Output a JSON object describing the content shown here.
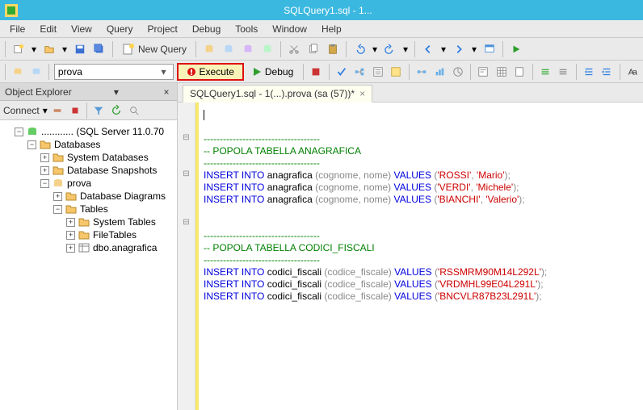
{
  "titlebar": {
    "title": "SQLQuery1.sql - 1..."
  },
  "menu": {
    "file": "File",
    "edit": "Edit",
    "view": "View",
    "query": "Query",
    "project": "Project",
    "debug": "Debug",
    "tools": "Tools",
    "window": "Window",
    "help": "Help"
  },
  "toolbar1": {
    "new_query": "New Query"
  },
  "toolbar2": {
    "combo_value": "prova",
    "execute": "Execute",
    "debug": "Debug"
  },
  "obj_explorer": {
    "title": "Object Explorer",
    "connect": "Connect"
  },
  "tree": {
    "server": "............ (SQL Server 11.0.70",
    "databases": "Databases",
    "sysdb": "System Databases",
    "snapshots": "Database Snapshots",
    "prova": "prova",
    "dbd": "Database Diagrams",
    "tables": "Tables",
    "systables": "System Tables",
    "filetables": "FileTables",
    "dbo": "dbo.anagrafica"
  },
  "tab": {
    "label": "SQLQuery1.sql - 1(...).prova (sa (57))*"
  },
  "code": {
    "dash": "------------------------------------",
    "c1": "-- POPOLA TABELLA ANAGRAFICA",
    "c2": "-- POPOLA TABELLA CODICI_FISCALI",
    "ins": "INSERT",
    "into": "INTO",
    "vals": "VALUES",
    "t1": "anagrafica",
    "cols1": "(cognome, nome)",
    "t2": "codici_fiscali",
    "cols2": "(codice_fiscale)",
    "v1a": "'ROSSI'",
    "v1b": "'Mario'",
    "v2a": "'VERDI'",
    "v2b": "'Michele'",
    "v3a": "'BIANCHI'",
    "v3b": "'Valerio'",
    "cf1": "'RSSMRM90M14L292L'",
    "cf2": "'VRDMHL99E04L291L'",
    "cf3": "'BNCVLR87B23L291L'"
  }
}
